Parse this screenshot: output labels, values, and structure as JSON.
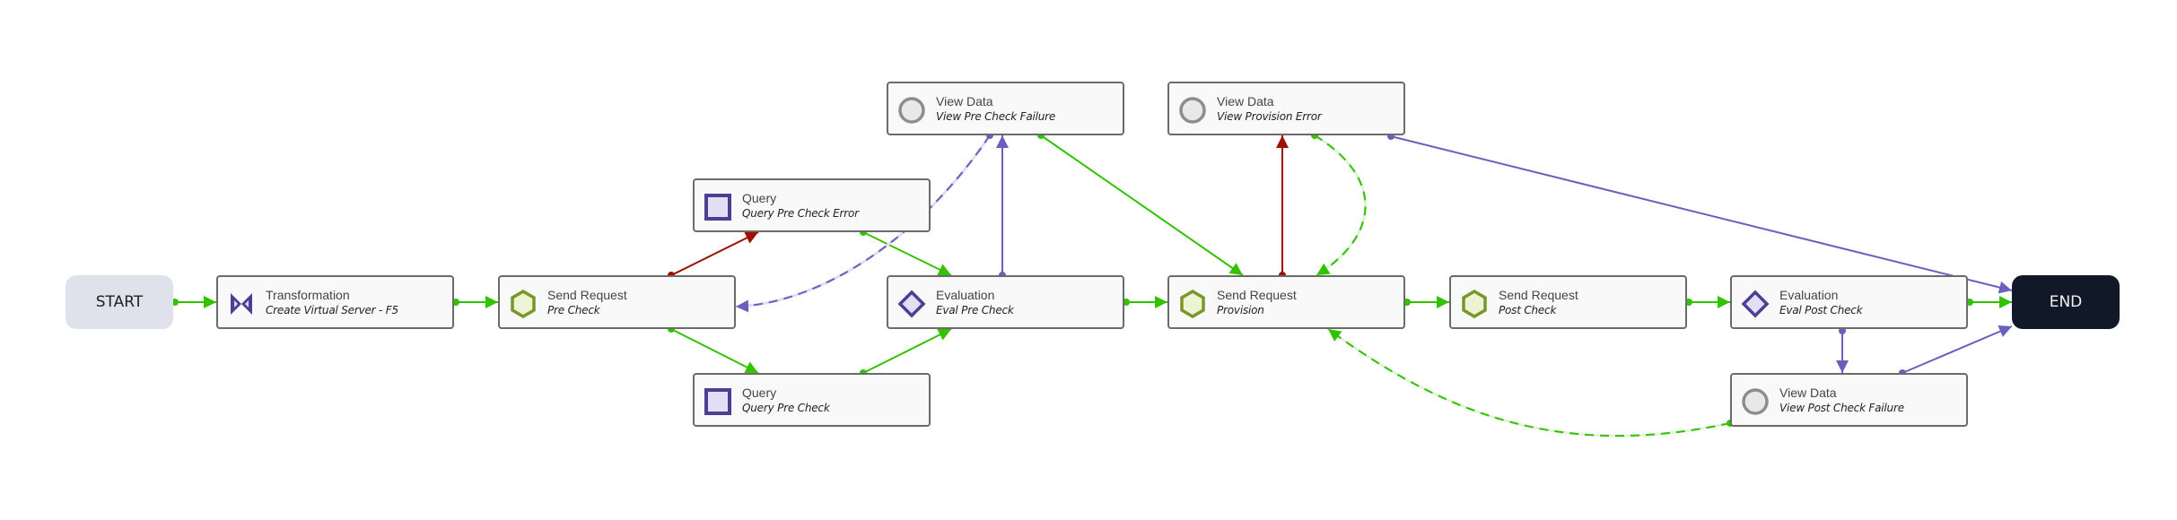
{
  "colors": {
    "success": "#33c200",
    "failure": "#a01000",
    "default": "#6a5fbd",
    "node_border": "#6b6b6b",
    "node_fill": "#f9f9f9",
    "start_fill": "#dfe1eb",
    "end_fill": "#111827"
  },
  "nodes": {
    "start": {
      "label": "START"
    },
    "end": {
      "label": "END"
    },
    "transformation": {
      "type": "Transformation",
      "name": "Create Virtual Server - F5",
      "icon": "bowtie-icon"
    },
    "send_pre": {
      "type": "Send Request",
      "name": "Pre Check",
      "icon": "hexagon-icon"
    },
    "query_error": {
      "type": "Query",
      "name": "Query Pre Check Error",
      "icon": "square-icon"
    },
    "query_pre": {
      "type": "Query",
      "name": "Query Pre Check",
      "icon": "square-icon"
    },
    "eval_pre": {
      "type": "Evaluation",
      "name": "Eval Pre Check",
      "icon": "diamond-icon"
    },
    "view_pre_fail": {
      "type": "View Data",
      "name": "View Pre Check Failure",
      "icon": "circle-icon"
    },
    "send_prov": {
      "type": "Send Request",
      "name": "Provision",
      "icon": "hexagon-icon"
    },
    "view_prov_err": {
      "type": "View Data",
      "name": "View Provision Error",
      "icon": "circle-icon"
    },
    "send_post": {
      "type": "Send Request",
      "name": "Post Check",
      "icon": "hexagon-icon"
    },
    "eval_post": {
      "type": "Evaluation",
      "name": "Eval Post Check",
      "icon": "diamond-icon"
    },
    "view_post_fail": {
      "type": "View Data",
      "name": "View Post Check Failure",
      "icon": "circle-icon"
    }
  },
  "edges": [
    {
      "from": "start",
      "to": "transformation",
      "kind": "success",
      "dashed": false
    },
    {
      "from": "transformation",
      "to": "send_pre",
      "kind": "success",
      "dashed": false
    },
    {
      "from": "send_pre",
      "to": "query_error",
      "kind": "failure",
      "dashed": false
    },
    {
      "from": "send_pre",
      "to": "query_pre",
      "kind": "success",
      "dashed": false
    },
    {
      "from": "query_error",
      "to": "eval_pre",
      "kind": "success",
      "dashed": false
    },
    {
      "from": "query_pre",
      "to": "eval_pre",
      "kind": "success",
      "dashed": false
    },
    {
      "from": "view_pre_fail",
      "to": "send_pre",
      "kind": "default",
      "dashed": true
    },
    {
      "from": "eval_pre",
      "to": "view_pre_fail",
      "kind": "default",
      "dashed": false
    },
    {
      "from": "view_pre_fail",
      "to": "send_prov",
      "kind": "success",
      "dashed": false
    },
    {
      "from": "eval_pre",
      "to": "send_prov",
      "kind": "success",
      "dashed": false
    },
    {
      "from": "send_prov",
      "to": "view_prov_err",
      "kind": "failure",
      "dashed": false
    },
    {
      "from": "view_prov_err",
      "to": "send_prov",
      "kind": "success",
      "dashed": true
    },
    {
      "from": "view_prov_err",
      "to": "end",
      "kind": "default",
      "dashed": false
    },
    {
      "from": "send_prov",
      "to": "send_post",
      "kind": "success",
      "dashed": false
    },
    {
      "from": "send_post",
      "to": "eval_post",
      "kind": "success",
      "dashed": false
    },
    {
      "from": "eval_post",
      "to": "end",
      "kind": "success",
      "dashed": false
    },
    {
      "from": "eval_post",
      "to": "view_post_fail",
      "kind": "default",
      "dashed": false
    },
    {
      "from": "view_post_fail",
      "to": "end",
      "kind": "default",
      "dashed": false
    },
    {
      "from": "view_post_fail",
      "to": "send_prov",
      "kind": "success",
      "dashed": true
    }
  ]
}
